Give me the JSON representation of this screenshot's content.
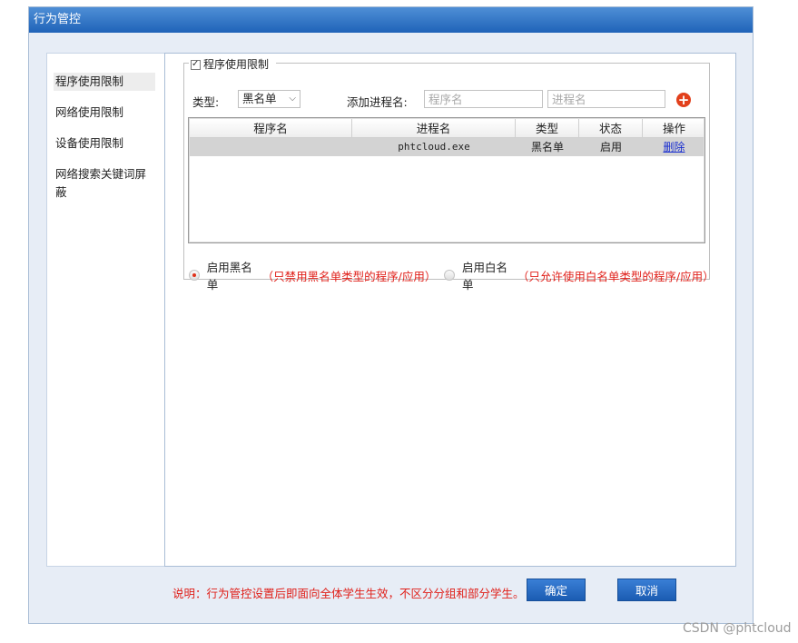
{
  "window": {
    "title": "行为管控"
  },
  "sidebar": {
    "items": [
      {
        "label": "程序使用限制",
        "active": true
      },
      {
        "label": "网络使用限制",
        "active": false
      },
      {
        "label": "设备使用限制",
        "active": false
      },
      {
        "label": "网络搜索关键词屏蔽",
        "active": false
      }
    ]
  },
  "group": {
    "legend": "程序使用限制",
    "checked": true,
    "type_label": "类型:",
    "type_value": "黑名单",
    "add_label": "添加进程名:",
    "program_placeholder": "程序名",
    "process_placeholder": "进程名",
    "add_icon": "plus-circle-icon"
  },
  "table": {
    "headers": [
      "程序名",
      "进程名",
      "类型",
      "状态",
      "操作"
    ],
    "rows": [
      {
        "program": "",
        "process": "phtcloud.exe",
        "type": "黑名单",
        "status": "启用",
        "action": "删除"
      }
    ]
  },
  "mode": {
    "blacklist_label": "启用黑名单",
    "blacklist_note": "（只禁用黑名单类型的程序/应用）",
    "whitelist_label": "启用白名单",
    "whitelist_note": "（只允许使用白名单类型的程序/应用）",
    "selected": "blacklist"
  },
  "footer": {
    "note": "说明：行为管控设置后即面向全体学生生效，不区分分组和部分学生。",
    "ok_label": "确定",
    "cancel_label": "取消"
  },
  "watermark": "CSDN @phtcloud",
  "colors": {
    "title_bar": "#2f72c6",
    "warning_text": "#e0201a",
    "button": "#2a6ec4"
  }
}
